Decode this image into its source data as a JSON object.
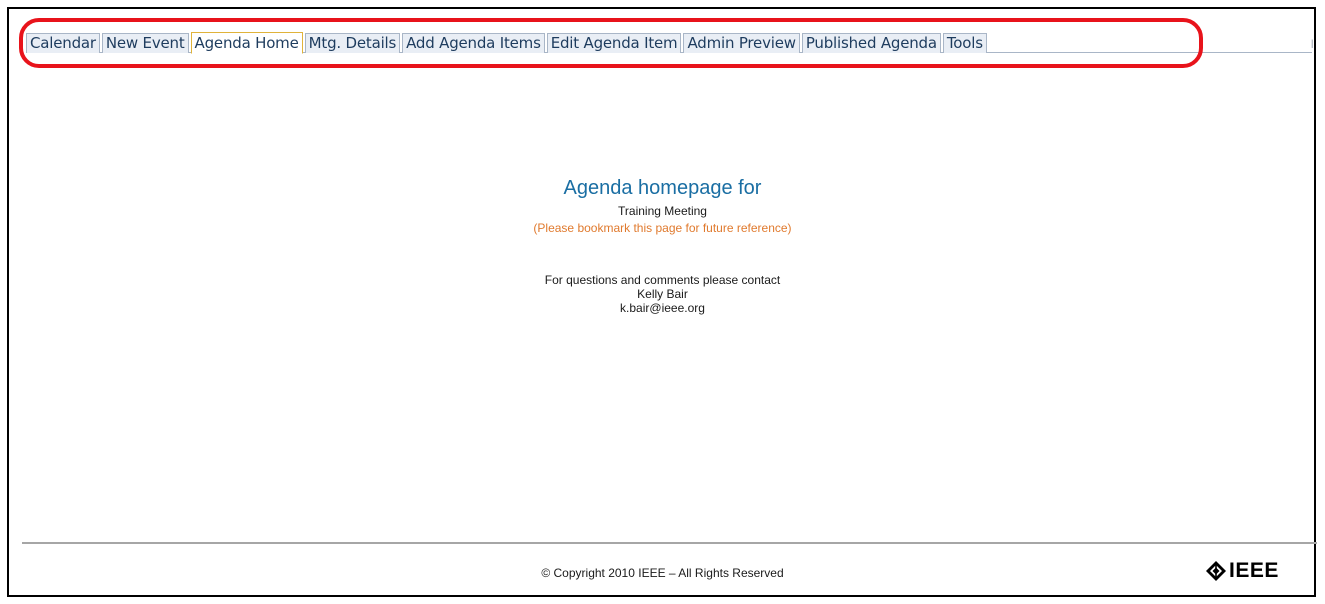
{
  "tabs": [
    {
      "label": "Calendar",
      "active": false
    },
    {
      "label": "New Event",
      "active": false
    },
    {
      "label": "Agenda Home",
      "active": true
    },
    {
      "label": "Mtg. Details",
      "active": false
    },
    {
      "label": "Add Agenda Items",
      "active": false
    },
    {
      "label": "Edit Agenda Item",
      "active": false
    },
    {
      "label": "Admin Preview",
      "active": false
    },
    {
      "label": "Published Agenda",
      "active": false
    },
    {
      "label": "Tools",
      "active": false
    }
  ],
  "main": {
    "heading": "Agenda homepage for",
    "meeting_name": "Training Meeting",
    "bookmark_note": "(Please bookmark this page for future reference)",
    "contact_intro": "For questions and comments please contact",
    "contact_name": "Kelly Bair",
    "contact_email": "k.bair@ieee.org"
  },
  "footer": {
    "copyright": "© Copyright 2010 IEEE – All Rights Reserved",
    "logo_text": "IEEE",
    "logo_icon": "ieee-diamond-icon"
  },
  "colors": {
    "highlight": "#e8131b",
    "heading": "#1a6ea3",
    "note": "#e07a2e",
    "tab_text": "#1e3c5e",
    "tab_bg": "#e9eef5",
    "active_tab_border": "#e0b33a"
  }
}
